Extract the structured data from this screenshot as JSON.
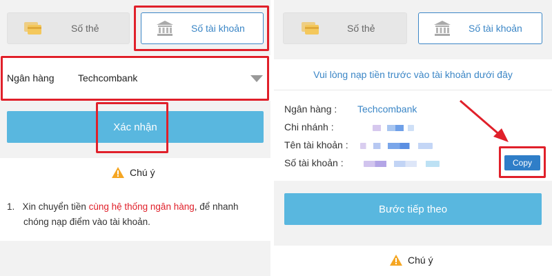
{
  "left": {
    "tabs": [
      {
        "label": "Số thẻ",
        "icon": "card-icon"
      },
      {
        "label": "Số tài khoản",
        "icon": "bank-icon"
      }
    ],
    "bank_label": "Ngân hàng",
    "bank_value": "Techcombank",
    "confirm_button": "Xác nhận",
    "notice_title": "Chú ý",
    "note": {
      "number": "1.",
      "text_before": "Xin chuyển tiền ",
      "text_highlight": "cùng hệ thống ngân hàng",
      "text_after_line1": ", để nhanh",
      "line2": "chóng nạp điểm vào tài khoản."
    }
  },
  "right": {
    "tabs": [
      {
        "label": "Số thẻ",
        "icon": "card-icon"
      },
      {
        "label": "Số tài khoản",
        "icon": "bank-icon"
      }
    ],
    "info_title": "Vui lòng nạp tiền trước vào tài khoản dưới đây",
    "fields": [
      {
        "label": "Ngân hàng :",
        "value": "Techcombank"
      },
      {
        "label": "Chi nhánh :",
        "value": ""
      },
      {
        "label": "Tên tài khoản :",
        "value": ""
      },
      {
        "label": "Số tài khoản :",
        "value": ""
      }
    ],
    "copy_button": "Copy",
    "next_button": "Bước tiếp theo",
    "notice_title": "Chú ý"
  },
  "colors": {
    "accent_blue": "#3b86c6",
    "button_blue": "#59b7df",
    "highlight_red": "#e0202a",
    "warning_yellow": "#f5a623"
  }
}
